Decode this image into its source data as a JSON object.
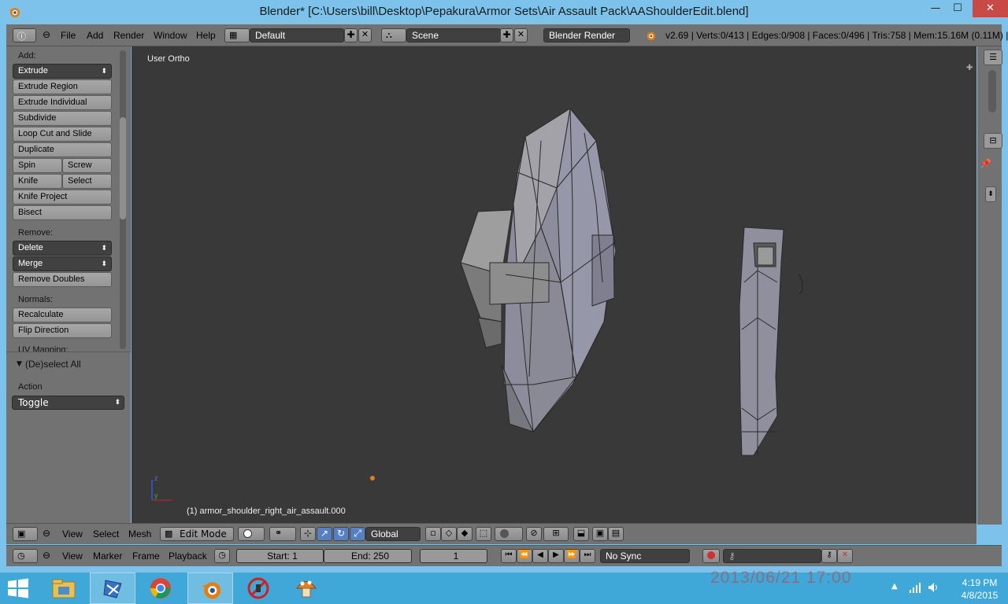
{
  "window": {
    "title": "Blender* [C:\\Users\\bill\\Desktop\\Pepakura\\Armor Sets\\Air Assault Pack\\AAShoulderEdit.blend]",
    "minimize": "—",
    "maximize": "☐",
    "close": "✕"
  },
  "info_header": {
    "menus": [
      "File",
      "Add",
      "Render",
      "Window",
      "Help"
    ],
    "layout": "Default",
    "scene": "Scene",
    "render_engine": "Blender Render",
    "stats": "v2.69 | Verts:0/413 | Edges:0/908 | Faces:0/496 | Tris:758 | Mem:15.16M (0.11M) |"
  },
  "toolshelf": {
    "add_label": "Add:",
    "extrude": "Extrude",
    "extrude_region": "Extrude Region",
    "extrude_individual": "Extrude Individual",
    "subdivide": "Subdivide",
    "loop_cut": "Loop Cut and Slide",
    "duplicate": "Duplicate",
    "spin": "Spin",
    "screw": "Screw",
    "knife": "Knife",
    "select": "Select",
    "knife_project": "Knife Project",
    "bisect": "Bisect",
    "remove_label": "Remove:",
    "delete": "Delete",
    "merge": "Merge",
    "remove_doubles": "Remove Doubles",
    "normals_label": "Normals:",
    "recalculate": "Recalculate",
    "flip_direction": "Flip Direction",
    "uv_label": "UV Mapping:"
  },
  "operator": {
    "title": "(De)select All",
    "action_label": "Action",
    "action_value": "Toggle"
  },
  "viewport": {
    "view_name": "User Ortho",
    "object_name": "(1) armor_shoulder_right_air_assault.000",
    "axis_z": "z",
    "axis_y": "y"
  },
  "view3d_header": {
    "menus": [
      "View",
      "Select",
      "Mesh"
    ],
    "mode": "Edit Mode",
    "orientation": "Global"
  },
  "timeline": {
    "menus": [
      "View",
      "Marker",
      "Frame",
      "Playback"
    ],
    "start": "Start: 1",
    "end": "End: 250",
    "current": "1",
    "sync": "No Sync"
  },
  "taskbar": {
    "time": "4:19 PM",
    "date": "4/8/2015",
    "stamp": "2013/06/21 17:00"
  },
  "colors": {
    "titlebar": "#7cc2ea",
    "panel": "#727272",
    "viewport": "#393939",
    "taskbar": "#3fa8d8",
    "mesh_face": "#8a8a9a"
  }
}
